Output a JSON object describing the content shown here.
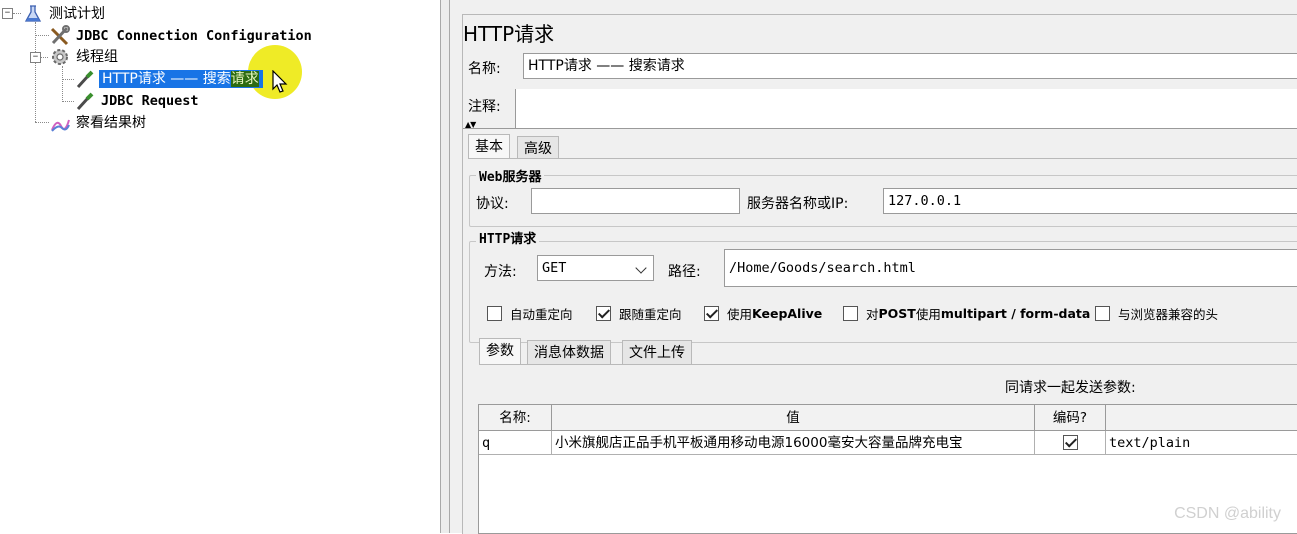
{
  "tree": {
    "root": "测试计划",
    "jdbc_config": "JDBC Connection Configuration",
    "thread_group": "线程组",
    "http_request_main": "HTTP请求 —— 搜索",
    "http_request_tail": "请求",
    "jdbc_request": "JDBC Request",
    "result_tree": "察看结果树",
    "toggle_collapse": "−"
  },
  "panel": {
    "title": "HTTP请求",
    "name_label": "名称:",
    "name_value": "HTTP请求 —— 搜索请求",
    "comment_label": "注释:",
    "comment_value": "",
    "divider_arrows": "▲▼"
  },
  "tabs": {
    "basic": "基本",
    "advanced": "高级"
  },
  "web_server": {
    "group_title": "Web服务器",
    "protocol_label": "协议:",
    "protocol_value": "",
    "server_label": "服务器名称或IP:",
    "server_value": "127.0.0.1"
  },
  "http_request": {
    "group_title": "HTTP请求",
    "method_label": "方法:",
    "method_value": "GET",
    "path_label": "路径:",
    "path_value": "/Home/Goods/search.html"
  },
  "options": {
    "auto_redirect": "自动重定向",
    "follow_redirect": "跟随重定向",
    "keepalive_prefix": "使用 ",
    "keepalive_suffix": "KeepAlive",
    "multipart_prefix": "对",
    "multipart_post": "POST",
    "multipart_mid": "使用",
    "multipart_suffix": "multipart / form-data",
    "browser_headers": "与浏览器兼容的头",
    "states": {
      "auto_redirect": false,
      "follow_redirect": true,
      "keepalive": true,
      "multipart": false,
      "browser_headers": false
    }
  },
  "sub_tabs": {
    "params": "参数",
    "body_data": "消息体数据",
    "file_upload": "文件上传"
  },
  "params_table": {
    "caption": "同请求一起发送参数:",
    "headers": {
      "name": "名称:",
      "value": "值",
      "encode": "编码?",
      "content_type": ""
    },
    "rows": [
      {
        "name": "q",
        "value": "小米旗舰店正品手机平板通用移动电源16000毫安大容量品牌充电宝",
        "encode": true,
        "content_type": "text/plain"
      }
    ]
  },
  "watermark": "CSDN @ability"
}
